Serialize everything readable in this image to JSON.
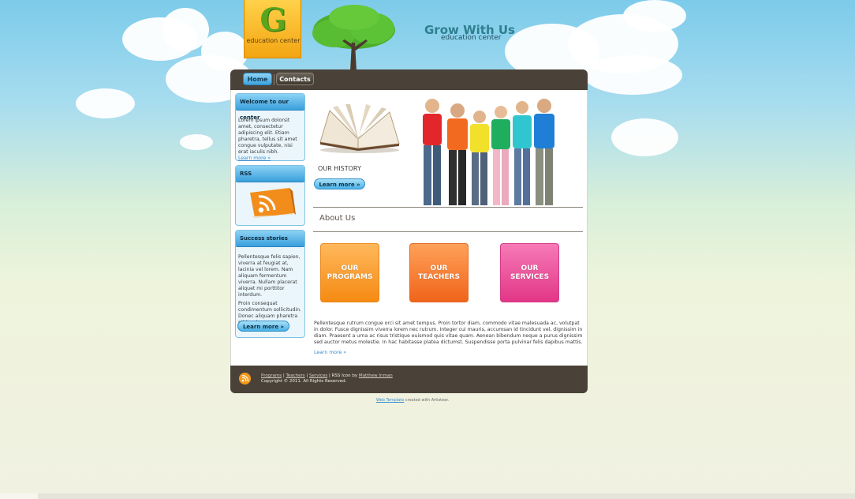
{
  "header": {
    "logo_letter": "G",
    "logo_sub": "education center",
    "site_title": "Grow With Us",
    "site_sub": "education center"
  },
  "nav": {
    "home": "Home",
    "contacts": "Contacts"
  },
  "sidebar": {
    "welcome": {
      "title": "Welcome to our center",
      "text": "Lorem ipsum dolorsit amet, consectetur adipiscing elit. Etiam pharetra, tellus sit amet congue vulputate, nisi erat iaculis nibh.",
      "link": "Learn more »"
    },
    "rss": {
      "title": "RSS"
    },
    "success": {
      "title": "Success stories",
      "text1": "Pellentesque felis sapien, viverra at feugiat at, lacinia vel lorem. Nam aliquam fermentum viverra. Nullam placerat aliquet mi porttitor interdum.",
      "text2": "Proin consequat condimentum sollicitudin. Donec aliquam pharetra nibh vel posuere.",
      "button": "Learn more »"
    }
  },
  "main": {
    "history_label": "OUR HISTORY",
    "history_button": "Learn more »",
    "about_title": "About Us",
    "tiles": [
      {
        "line1": "OUR",
        "line2": "PROGRAMS"
      },
      {
        "line1": "OUR",
        "line2": "TEACHERS"
      },
      {
        "line1": "OUR",
        "line2": "SERVICES"
      }
    ],
    "body_text": "Pellentesque rutrum congue orci sit amet tempus. Proin tortor diam, commodo vitae malesuada ac, volutpat in dolor. Fusce dignissim viverra lorem nec rutrum. Integer cui mauris, accumsan id tincidunt vel, dignissim in diam. Praesent a urna ac risus tristique euismod quis vitae quam. Aenean bibendum neque a purus dignissim sed auctor metus molestie. In hac habitasse platea dictumst. Suspendisse porta pulvinar felis dapibus mattis.",
    "link": "Learn more »"
  },
  "footer": {
    "programs": "Programs",
    "teachers": "Teachers",
    "services": "Services",
    "sep": "|",
    "rss_by": "RSS Icon by",
    "author": "Matthew Inman",
    "copyright": "Copyright © 2011. All Rights Reserved."
  },
  "credit": {
    "link": "Web Template",
    "text": "created with Artisteer."
  },
  "colors": {
    "nav_bg": "#4a4239",
    "accent_blue": "#3aa0dc",
    "orange": "#f58a12",
    "pink": "#e23687"
  },
  "icons": [
    "tree-image",
    "book-image",
    "children-photo",
    "rss-icon"
  ]
}
